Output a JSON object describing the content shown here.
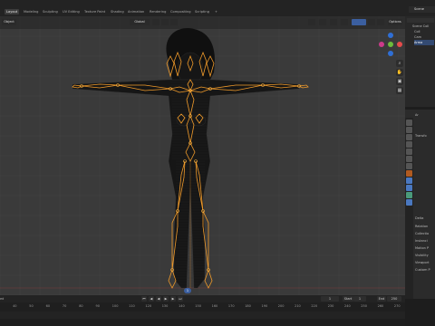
{
  "menu": {
    "tabs": [
      "Layout",
      "Modeling",
      "Sculpting",
      "UV Editing",
      "Texture Paint",
      "Shading",
      "Animation",
      "Rendering",
      "Compositing",
      "Scripting",
      "+"
    ],
    "active_tab": "Layout",
    "scene_name": "Scene"
  },
  "viewport": {
    "mode_label": "Object",
    "orientation_label": "Global",
    "options_label": "Options",
    "accent_color": "#f09a2a",
    "bone_color": "#e8902a",
    "mesh_color": "#141414"
  },
  "navigation": {
    "axis_x_label": "X",
    "axis_y_label": "Y",
    "axis_z_label": "Z"
  },
  "outliner": {
    "items": [
      "Scene Coll",
      "Coll",
      "Cam",
      "Arma"
    ]
  },
  "properties": {
    "header": "Ar",
    "transform_label": "Transfo",
    "sections": [
      "Delta",
      "Relation",
      "Collectio",
      "Instanci",
      "Motion P",
      "Visibility",
      "Viewport",
      "Custom P"
    ]
  },
  "timeline": {
    "current_frame": "1",
    "start_label": "Start",
    "start_value": "1",
    "end_label": "End",
    "end_value": "250",
    "playhead_label": "1",
    "ruler_ticks": [
      "40",
      "50",
      "60",
      "70",
      "80",
      "90",
      "100",
      "110",
      "120",
      "130",
      "140",
      "150",
      "160",
      "170",
      "180",
      "190",
      "200",
      "210",
      "220",
      "230",
      "240",
      "250",
      "260",
      "270"
    ],
    "left_label": "ed"
  }
}
